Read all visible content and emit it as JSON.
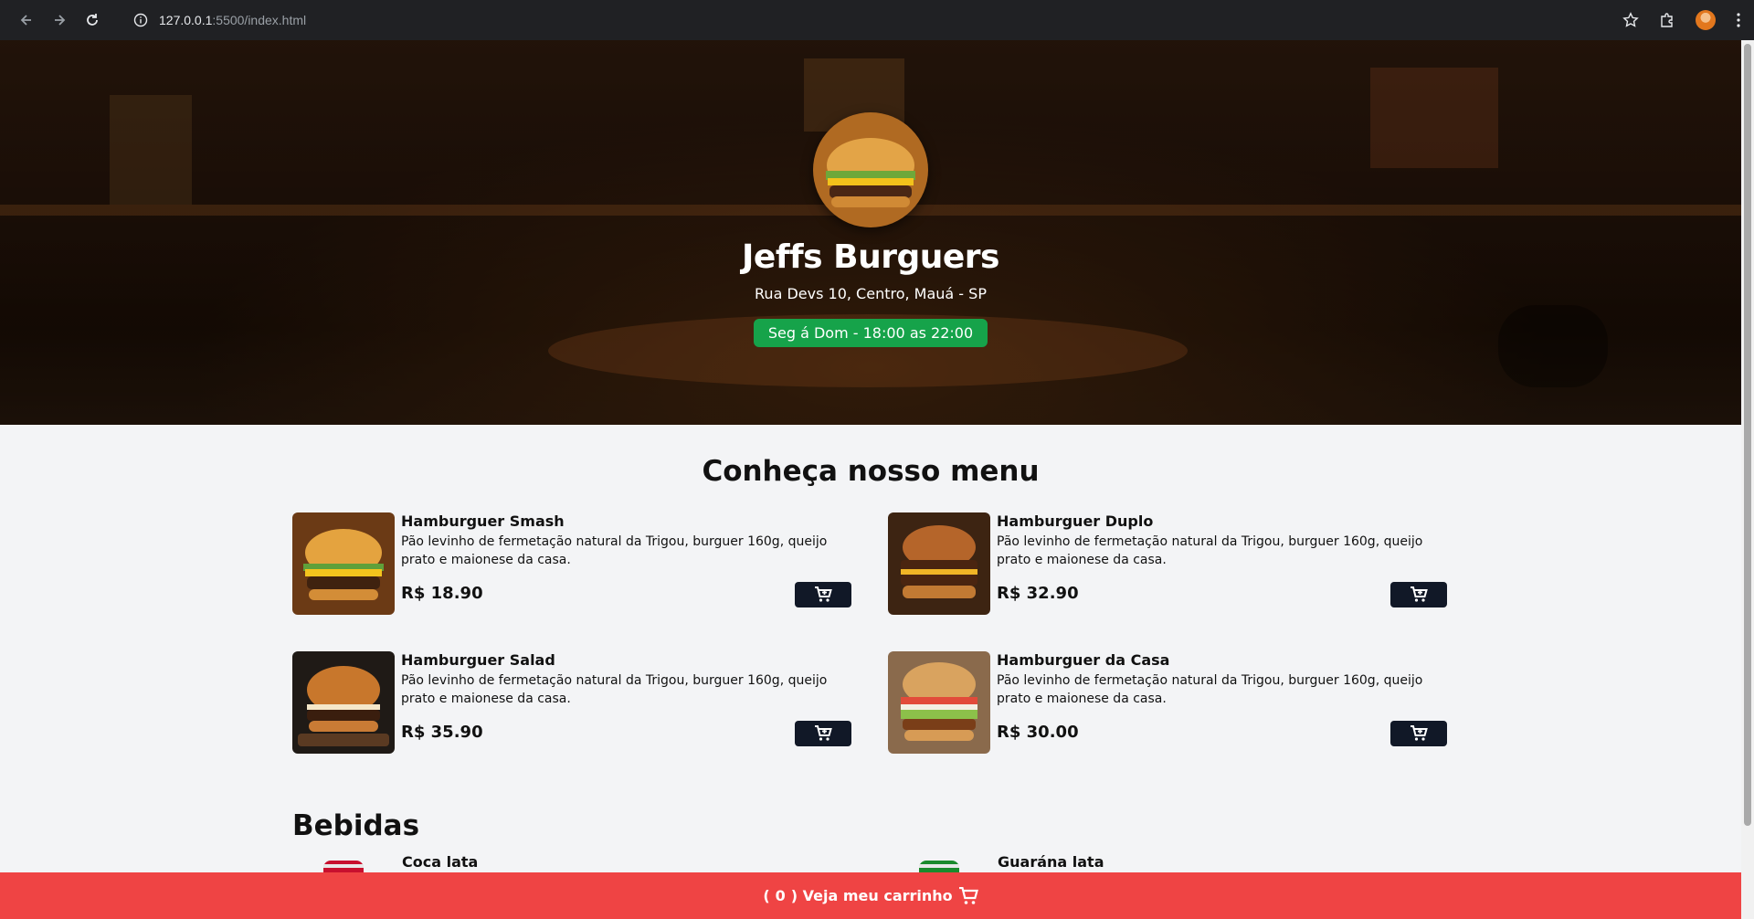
{
  "browser": {
    "url_host": "127.0.0.1",
    "url_path": ":5500/index.html"
  },
  "hero": {
    "name": "Jeffs Burguers",
    "address": "Rua Devs 10, Centro, Mauá - SP",
    "hours": "Seg á Dom - 18:00 as 22:00"
  },
  "menu": {
    "title": "Conheça nosso menu",
    "items": [
      {
        "name": "Hamburguer Smash",
        "description": "Pão levinho de fermetação natural da Trigou, burguer 160g, queijo prato e maionese da casa.",
        "price": "R$ 18.90"
      },
      {
        "name": "Hamburguer Duplo",
        "description": "Pão levinho de fermetação natural da Trigou, burguer 160g, queijo prato e maionese da casa.",
        "price": "R$ 32.90"
      },
      {
        "name": "Hamburguer Salad",
        "description": "Pão levinho de fermetação natural da Trigou, burguer 160g, queijo prato e maionese da casa.",
        "price": "R$ 35.90"
      },
      {
        "name": "Hamburguer da Casa",
        "description": "Pão levinho de fermetação natural da Trigou, burguer 160g, queijo prato e maionese da casa.",
        "price": "R$ 30.00"
      }
    ]
  },
  "drinks": {
    "title": "Bebidas",
    "items": [
      {
        "name": "Coca lata"
      },
      {
        "name": "Guarána lata"
      }
    ]
  },
  "footer": {
    "open_paren": "(",
    "count": "0",
    "label": ") Veja meu carrinho"
  },
  "colors": {
    "accent_green": "#16a34a",
    "footer_red": "#ef4444",
    "button_dark": "#111827"
  }
}
